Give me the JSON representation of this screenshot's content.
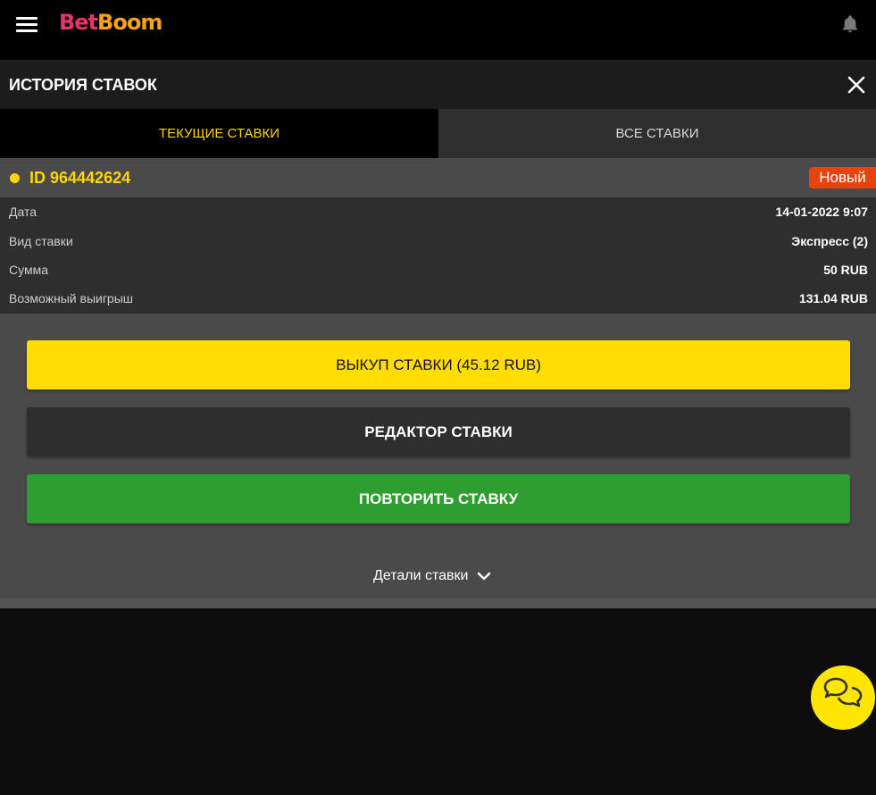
{
  "brand": {
    "part1": "Bet",
    "part2": "Boom"
  },
  "header": {
    "title": "ИСТОРИЯ СТАВОК"
  },
  "tabs": [
    {
      "label": "ТЕКУЩИЕ СТАВКИ",
      "active": true
    },
    {
      "label": "ВСЕ СТАВКИ",
      "active": false
    }
  ],
  "bet": {
    "id": "ID 964442624",
    "status": "Новый",
    "rows": [
      {
        "label": "Дата",
        "value": "14-01-2022 9:07"
      },
      {
        "label": "Вид ставки",
        "value": "Экспресс (2)"
      },
      {
        "label": "Сумма",
        "value": "50 RUB"
      },
      {
        "label": "Возможный выигрыш",
        "value": "131.04 RUB"
      }
    ]
  },
  "buttons": {
    "cashout": "ВЫКУП СТАВКИ (45.12 RUB)",
    "edit": "РЕДАКТОР СТАВКИ",
    "repeat": "ПОВТОРИТЬ СТАВКУ"
  },
  "details_label": "Детали ставки",
  "colors": {
    "accent": "#ffd600",
    "badge": "#e8420d",
    "repeat": "#2f9e30"
  },
  "icons": [
    "hamburger-icon",
    "bell-icon",
    "close-icon",
    "chevron-down-icon",
    "chat-icon"
  ]
}
